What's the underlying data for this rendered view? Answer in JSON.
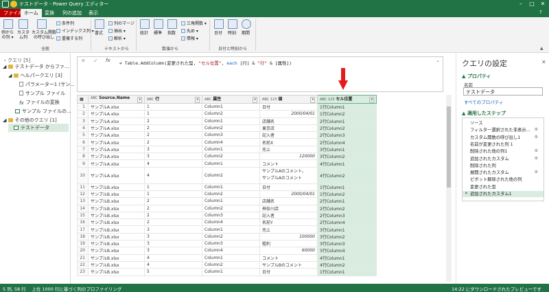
{
  "window": {
    "title": "テストデータ - Power Query エディター"
  },
  "tabs": [
    {
      "label": "ファイル"
    },
    {
      "label": "ホーム"
    },
    {
      "label": "変換"
    },
    {
      "label": "列の追加"
    },
    {
      "label": "表示"
    }
  ],
  "ribbon": {
    "big_buttons": [
      {
        "label1": "例から",
        "label2": "の列 ▾"
      },
      {
        "label1": "カスタ",
        "label2": "ム列"
      },
      {
        "label1": "カスタム関数",
        "label2": "の呼び出し"
      }
    ],
    "small_buttons": [
      "条件列",
      "インデックス列 ▾",
      "重複する列"
    ],
    "format": "書式",
    "extract": "抽出 ▾",
    "parse": "解析 ▾",
    "merge": "列のマージ",
    "stats": "統計",
    "std": "標準",
    "sci": "指数",
    "trig": "三角関数 ▾",
    "round": "丸め ▾",
    "info": "情報 ▾",
    "date": "日付",
    "time": "時刻",
    "duration": "期間",
    "groups": [
      "全般",
      "テキストから",
      "数値から",
      "日付と時刻から"
    ]
  },
  "queries": {
    "header": "クエリ [5]",
    "items": [
      "テストデータ からファ...",
      "ヘルパークエリ [3]",
      "パラメーター1 (サン...",
      "サンプル ファイル",
      "ファイルの変換",
      "サンプル ファイルの...",
      "その他のクエリ [1]",
      "テストデータ"
    ]
  },
  "formula": {
    "prefix": "= Table.AddColumn(変更された型, ",
    "s1": "\"セル位置\"",
    "mid": ", ",
    "kw": "each",
    "rest1": " [行] & ",
    "s2": "\"行\"",
    "rest2": " & [属性])"
  },
  "columns": [
    {
      "type": "ABC",
      "name": "Source.Name"
    },
    {
      "type": "ABC",
      "name": "行"
    },
    {
      "type": "ABC",
      "name": "属性"
    },
    {
      "type": "ABC 123",
      "name": "値"
    },
    {
      "type": "ABC 123",
      "name": "セル位置"
    }
  ],
  "rows": [
    [
      "1",
      "サンプルA.xlsx",
      "1",
      "Column1",
      "日付",
      "1行Column1"
    ],
    [
      "2",
      "サンプルA.xlsx",
      "1",
      "Column2",
      "2000/04/01",
      "1行Column2"
    ],
    [
      "3",
      "サンプルA.xlsx",
      "2",
      "Column1",
      "店舗名",
      "2行Column1"
    ],
    [
      "4",
      "サンプルA.xlsx",
      "2",
      "Column2",
      "東京店",
      "2行Column2"
    ],
    [
      "5",
      "サンプルA.xlsx",
      "2",
      "Column3",
      "記入者",
      "2行Column3"
    ],
    [
      "6",
      "サンプルA.xlsx",
      "2",
      "Column4",
      "名前X",
      "2行Column4"
    ],
    [
      "7",
      "サンプルA.xlsx",
      "3",
      "Column1",
      "売上",
      "3行Column1"
    ],
    [
      "8",
      "サンプルA.xlsx",
      "3",
      "Column2",
      "120000",
      "3行Column2"
    ],
    [
      "9",
      "サンプルA.xlsx",
      "4",
      "Column1",
      "コメント",
      "4行Column1"
    ],
    [
      "10",
      "サンプルA.xlsx",
      "4",
      "Column2",
      "サンプルAのコメント。\nサンプルAのコメント",
      "4行Column2"
    ],
    [
      "11",
      "サンプルB.xlsx",
      "1",
      "Column1",
      "日付",
      "1行Column1"
    ],
    [
      "12",
      "サンプルB.xlsx",
      "1",
      "Column2",
      "2000/04/01",
      "1行Column2"
    ],
    [
      "13",
      "サンプルB.xlsx",
      "2",
      "Column1",
      "店舗名",
      "2行Column1"
    ],
    [
      "14",
      "サンプルB.xlsx",
      "2",
      "Column2",
      "神奈川店",
      "2行Column2"
    ],
    [
      "15",
      "サンプルB.xlsx",
      "2",
      "Column3",
      "記入者",
      "2行Column3"
    ],
    [
      "16",
      "サンプルB.xlsx",
      "2",
      "Column4",
      "名前Y",
      "2行Column4"
    ],
    [
      "17",
      "サンプルB.xlsx",
      "3",
      "Column1",
      "売上",
      "3行Column1"
    ],
    [
      "18",
      "サンプルB.xlsx",
      "3",
      "Column2",
      "100000",
      "3行Column2"
    ],
    [
      "19",
      "サンプルB.xlsx",
      "3",
      "Column3",
      "粗利",
      "3行Column3"
    ],
    [
      "20",
      "サンプルB.xlsx",
      "3",
      "Column4",
      "60000",
      "3行Column4"
    ],
    [
      "21",
      "サンプルB.xlsx",
      "4",
      "Column1",
      "コメント",
      "4行Column1"
    ],
    [
      "22",
      "サンプルB.xlsx",
      "4",
      "Column2",
      "サンプルBのコメント",
      "4行Column2"
    ],
    [
      "23",
      "サンプルB.xlsx",
      "5",
      "Column1",
      "日付",
      "1行Column1"
    ]
  ],
  "right_pane": {
    "title": "クエリの設定",
    "props_header": "▲ プロパティ",
    "name_label": "名前",
    "name_value": "テストデータ",
    "all_props": "すべてのプロパティ",
    "steps_header": "▲ 適用したステップ",
    "steps": [
      "ソース",
      "フィルター選択された非表示...",
      "カスタム関数の呼び出し1",
      "名前が変更された列 1",
      "削除された他の列1",
      "追加されたカスタム",
      "削除された列",
      "展開されたカスタム",
      "ピボット解除された他の列",
      "変更された型",
      "追加されたカスタム1"
    ]
  },
  "status": {
    "left": "5 列, 58 行　 上位 1000 行に基づく列のプロファイリング",
    "right": "14:22 にダウンロードされたプレビューです"
  },
  "colors": {
    "accent": "#217346",
    "highlight": "#d8ecdf",
    "arrow": "#e51c1c"
  }
}
